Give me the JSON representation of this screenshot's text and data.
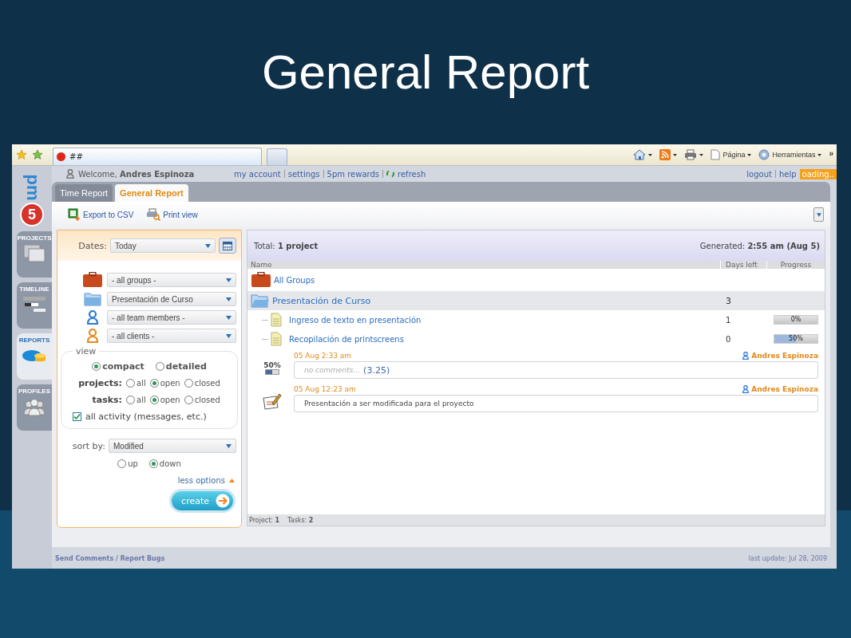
{
  "slide": {
    "title": "General Report"
  },
  "browser": {
    "tab_title": "##",
    "tools": [
      {
        "kind": "home"
      },
      {
        "kind": "rss"
      },
      {
        "kind": "print"
      },
      {
        "kind": "page",
        "label": "Página"
      },
      {
        "kind": "tools",
        "label": "Herramientas"
      }
    ],
    "more": "»"
  },
  "app": {
    "logo": {
      "digit": "5",
      "word": "pm"
    },
    "welcome": "Welcome,",
    "user": "Andres Espinoza",
    "links": [
      {
        "label": "my account",
        "kind": "plain"
      },
      {
        "label": "settings",
        "kind": "plain"
      },
      {
        "label": "5pm rewards",
        "kind": "plain"
      },
      {
        "label": "refresh",
        "kind": "refresh"
      }
    ],
    "right_links": [
      "logout",
      "help"
    ],
    "loading": "oading..",
    "side_nav": [
      {
        "label": "PROJECTS",
        "kind": "projects",
        "selected": false
      },
      {
        "label": "TIMELINE",
        "kind": "timeline",
        "selected": false
      },
      {
        "label": "REPORTS",
        "kind": "reports",
        "selected": true
      },
      {
        "label": "PROFILES",
        "kind": "profiles",
        "selected": false
      }
    ],
    "tabs": [
      {
        "label": "Time Report",
        "selected": false
      },
      {
        "label": "General Report",
        "selected": true
      }
    ],
    "actions": [
      {
        "kind": "csv",
        "label": "Export to CSV"
      },
      {
        "kind": "print",
        "label": "Print view"
      }
    ]
  },
  "filters": {
    "dates_label": "Dates:",
    "dates_value": "Today",
    "selects": [
      {
        "kind": "group",
        "value": "- all groups -"
      },
      {
        "kind": "project",
        "value": "Presentación de Curso"
      },
      {
        "kind": "member",
        "value": "- all team members -"
      },
      {
        "kind": "client",
        "value": "- all clients -"
      }
    ],
    "view": {
      "legend": "view",
      "options": [
        {
          "label": "compact",
          "selected": true
        },
        {
          "label": "detailed",
          "selected": false
        }
      ]
    },
    "projects": {
      "label": "projects:",
      "options": [
        {
          "label": "all",
          "selected": false
        },
        {
          "label": "open",
          "selected": true
        },
        {
          "label": "closed",
          "selected": false
        }
      ]
    },
    "tasks": {
      "label": "tasks:",
      "options": [
        {
          "label": "all",
          "selected": false
        },
        {
          "label": "open",
          "selected": true
        },
        {
          "label": "closed",
          "selected": false
        }
      ]
    },
    "all_activity": {
      "label": "all activity (messages, etc.)",
      "checked": true
    },
    "sort": {
      "label": "sort by:",
      "value": "Modified",
      "options": [
        {
          "label": "up",
          "selected": false
        },
        {
          "label": "down",
          "selected": true
        }
      ]
    },
    "less_options": "less options",
    "create": "create"
  },
  "report": {
    "total_label": "Total:",
    "total": "1 project",
    "generated_label": "Generated:",
    "generated": "2:55 am (Aug 5)",
    "columns": [
      "Name",
      "Days left",
      "Progress"
    ],
    "rows": [
      {
        "kind": "group",
        "name": "All Groups"
      },
      {
        "kind": "project",
        "name": "Presentación de Curso",
        "days": "3"
      },
      {
        "kind": "task",
        "name": "Ingreso de texto en presentación",
        "days": "1",
        "level": 0,
        "progress": "0%"
      },
      {
        "kind": "task",
        "name": "Recopilación de printscreens",
        "days": "0",
        "level": 0.5,
        "progress": "50%"
      }
    ],
    "activity": [
      {
        "kind": "progress",
        "time": "05 Aug 2:33 am",
        "author": "Andres Espinoza",
        "percent": "50%",
        "level": 0.5,
        "text": "no comments...",
        "hours": "(3.25)"
      },
      {
        "kind": "note",
        "time": "05 Aug 12:23 am",
        "author": "Andres Espinoza",
        "text": "Presentación a ser modificada para el proyecto"
      }
    ],
    "counts": [
      {
        "label": "Project:",
        "value": "1"
      },
      {
        "label": "Tasks:",
        "value": "2"
      }
    ]
  },
  "footer": {
    "link": "Send Comments / Report Bugs",
    "last_update": "last update: Jul 28, 2009"
  }
}
